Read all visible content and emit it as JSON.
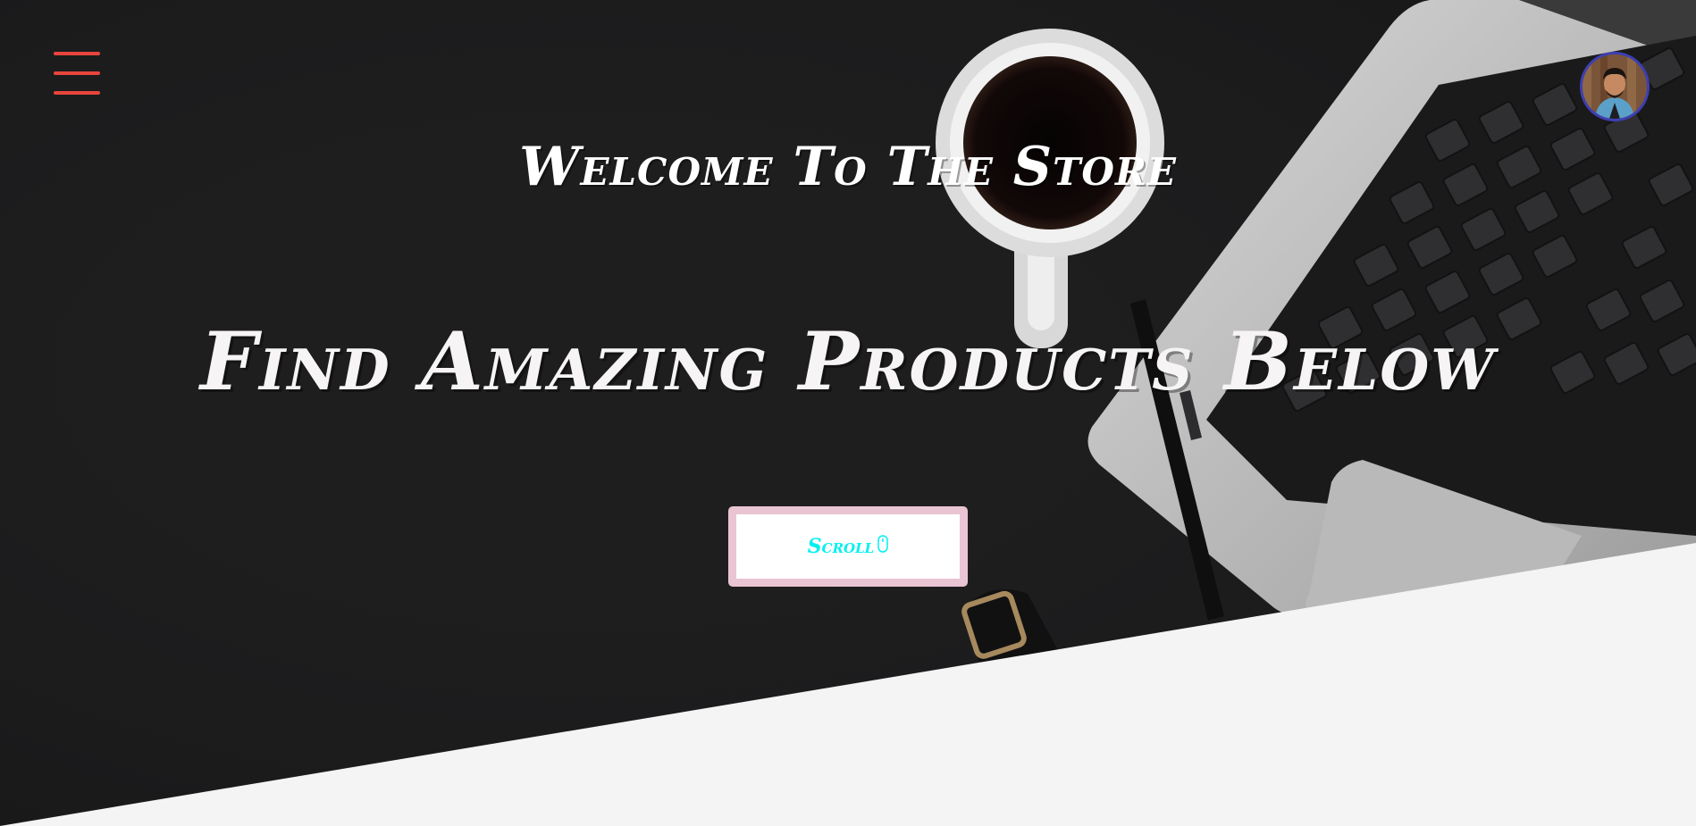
{
  "hero": {
    "welcome": "Welcome To The Store",
    "headline": "Find Amazing Products Below",
    "scroll_label": "Scroll",
    "scroll_icon": "mouse-icon",
    "menu_icon": "hamburger-menu-icon",
    "avatar_icon": "user-avatar"
  },
  "colors": {
    "hero_background": "#1c1c1d",
    "lower_background": "#f4f4f4",
    "menu_icon": "#e8453c",
    "heading_text": "#ffffff",
    "button_background": "#ffffff",
    "button_border": "#e9c4d2",
    "button_text": "#00f0f0",
    "avatar_ring": "#3d3fb5"
  }
}
